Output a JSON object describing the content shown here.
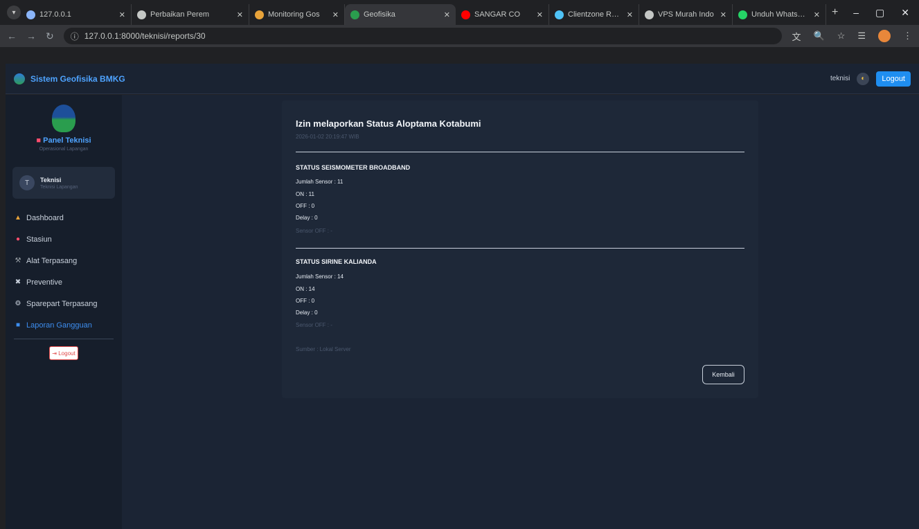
{
  "browser": {
    "tabs": [
      {
        "label": "127.0.0.1",
        "favicon_color": "#8ab4f8",
        "active": false
      },
      {
        "label": "Perbaikan Perem",
        "favicon_color": "#c4c7c5",
        "active": false
      },
      {
        "label": "Monitoring Gos",
        "favicon_color": "#e8a33a",
        "active": false
      },
      {
        "label": "Geofisika",
        "favicon_color": "#2a9d4e",
        "active": true
      },
      {
        "label": "SANGAR CO",
        "favicon_color": "#ff0000",
        "active": false
      },
      {
        "label": "Clientzone Rumah",
        "favicon_color": "#4fc3f7",
        "active": false
      },
      {
        "label": "VPS Murah Indo",
        "favicon_color": "#c4c7c5",
        "active": false
      },
      {
        "label": "Unduh WhatsApp",
        "favicon_color": "#25d366",
        "active": false
      }
    ],
    "url": "127.0.0.1:8000/teknisi/reports/30"
  },
  "header": {
    "brand": "Sistem Geofisika BMKG",
    "user": "teknisi",
    "logout_label": "Logout"
  },
  "sidebar": {
    "panel_title": "Panel Teknisi",
    "panel_subtitle": "Operasional Lapangan",
    "user_name": "Teknisi",
    "user_role": "Teknisi Lapangan",
    "menu": [
      {
        "label": "Dashboard",
        "icon": "dashboard-icon",
        "glyph": "▲",
        "color": "#e8a33a",
        "active": false
      },
      {
        "label": "Stasiun",
        "icon": "pin-icon",
        "glyph": "●",
        "color": "#ff4d6d",
        "active": false
      },
      {
        "label": "Alat Terpasang",
        "icon": "tool-icon",
        "glyph": "⚒",
        "color": "#9aa0a6",
        "active": false
      },
      {
        "label": "Preventive",
        "icon": "wrench-icon",
        "glyph": "✖",
        "color": "#c9d1dc",
        "active": false
      },
      {
        "label": "Sparepart Terpasang",
        "icon": "gear-icon",
        "glyph": "⚙",
        "color": "#c9d1dc",
        "active": false
      },
      {
        "label": "Laporan Gangguan",
        "icon": "report-icon",
        "glyph": "■",
        "color": "#3d8ef0",
        "active": true
      }
    ],
    "logout_label": "Logout"
  },
  "report": {
    "title": "Izin melaporkan Status Aloptama Kotabumi",
    "date": "2026-01-02 20:19:47 WIB",
    "sections": [
      {
        "title": "STATUS SEISMOMETER BROADBAND",
        "total": "Jumlah Sensor : 11",
        "on": "ON : 11",
        "off": "OFF : 0",
        "delay": "Delay : 0",
        "note": "Sensor OFF : -"
      },
      {
        "title": "STATUS SIRINE KALIANDA",
        "total": "Jumlah Sensor : 14",
        "on": "ON : 14",
        "off": "OFF : 0",
        "delay": "Delay : 0",
        "note": "Sensor OFF : -"
      }
    ],
    "footer_note": "Sumber : Lokal Server",
    "back_label": "Kembali"
  }
}
